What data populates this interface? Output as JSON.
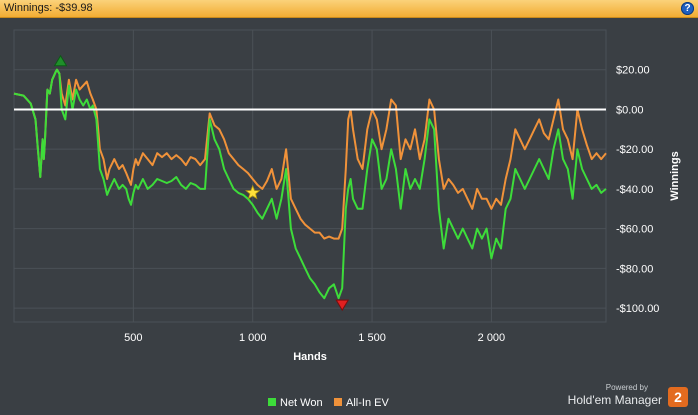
{
  "header": {
    "title": "Winnings: -$39.98",
    "help_label": "?"
  },
  "brand": {
    "powered_by": "Powered by",
    "name": "Hold'em Manager",
    "version": "2"
  },
  "colors": {
    "net_won": "#3ddc3a",
    "all_in_ev": "#f0923a",
    "zero_line": "#ffffff",
    "grid": "#4b5157",
    "plot_bg": "#3a3f44",
    "high_marker": "#1f8f2a",
    "low_marker": "#e02020",
    "star_marker": "#ffe03a"
  },
  "chart_data": {
    "type": "line",
    "xlabel": "Hands",
    "ylabel": "Winnings",
    "xlim": [
      0,
      2480
    ],
    "ylim": [
      -107,
      40
    ],
    "x_ticks": [
      500,
      1000,
      1500,
      2000
    ],
    "x_tick_labels": [
      "500",
      "1 000",
      "1 500",
      "2 000"
    ],
    "y_ticks": [
      20,
      0,
      -20,
      -40,
      -60,
      -80,
      -100
    ],
    "y_tick_labels": [
      "$20.00",
      "$0.00",
      "-$20.00",
      "-$40.00",
      "-$60.00",
      "-$80.00",
      "-$100.00"
    ],
    "grid": true,
    "legend_position": "bottom",
    "series": [
      {
        "name": "Net Won",
        "x": [
          0,
          40,
          70,
          90,
          100,
          110,
          120,
          125,
          130,
          140,
          150,
          160,
          175,
          180,
          190,
          200,
          215,
          230,
          245,
          260,
          275,
          290,
          305,
          320,
          330,
          345,
          360,
          375,
          390,
          400,
          420,
          440,
          455,
          470,
          480,
          490,
          500,
          510,
          520,
          540,
          560,
          580,
          600,
          620,
          640,
          660,
          680,
          700,
          720,
          740,
          760,
          780,
          800,
          820,
          840,
          860,
          880,
          900,
          920,
          940,
          960,
          980,
          1000,
          1020,
          1040,
          1060,
          1080,
          1100,
          1120,
          1140,
          1160,
          1180,
          1200,
          1220,
          1240,
          1260,
          1280,
          1300,
          1320,
          1340,
          1360,
          1375,
          1390,
          1400,
          1410,
          1420,
          1440,
          1460,
          1480,
          1500,
          1520,
          1540,
          1560,
          1580,
          1600,
          1620,
          1640,
          1660,
          1680,
          1700,
          1720,
          1740,
          1760,
          1780,
          1800,
          1820,
          1840,
          1860,
          1880,
          1900,
          1920,
          1940,
          1960,
          1980,
          2000,
          2020,
          2040,
          2060,
          2080,
          2100,
          2120,
          2140,
          2160,
          2180,
          2200,
          2220,
          2240,
          2260,
          2280,
          2300,
          2320,
          2340,
          2360,
          2380,
          2400,
          2420,
          2440,
          2460,
          2480
        ],
        "values": [
          8,
          7,
          3,
          -5,
          -20,
          -34,
          -15,
          -25,
          -15,
          10,
          8,
          15,
          19,
          20,
          18,
          0,
          -5,
          12,
          0,
          10,
          5,
          2,
          5,
          0,
          2,
          -5,
          -30,
          -35,
          -43,
          -40,
          -35,
          -40,
          -38,
          -40,
          -45,
          -48,
          -42,
          -38,
          -40,
          -35,
          -40,
          -38,
          -35,
          -36,
          -37,
          -36,
          -34,
          -38,
          -40,
          -37,
          -38,
          -40,
          -40,
          -5,
          -15,
          -20,
          -30,
          -35,
          -40,
          -42,
          -43,
          -45,
          -48,
          -52,
          -55,
          -50,
          -45,
          -55,
          -45,
          -30,
          -60,
          -70,
          -75,
          -80,
          -85,
          -88,
          -92,
          -95,
          -90,
          -88,
          -95,
          -90,
          -50,
          -40,
          -35,
          -45,
          -50,
          -50,
          -30,
          -15,
          -20,
          -40,
          -35,
          -20,
          -30,
          -50,
          -30,
          -40,
          -35,
          -40,
          -25,
          -5,
          -10,
          -50,
          -70,
          -55,
          -60,
          -65,
          -60,
          -65,
          -70,
          -60,
          -65,
          -60,
          -75,
          -65,
          -70,
          -50,
          -45,
          -30,
          -35,
          -40,
          -35,
          -30,
          -25,
          -30,
          -35,
          -20,
          -10,
          -25,
          -30,
          -45,
          -20,
          -30,
          -35,
          -40,
          -38,
          -42,
          -40
        ],
        "color": "#3ddc3a"
      },
      {
        "name": "All-In EV",
        "x": [
          0,
          40,
          70,
          90,
          100,
          110,
          120,
          125,
          130,
          140,
          150,
          160,
          175,
          180,
          190,
          200,
          215,
          230,
          245,
          260,
          275,
          290,
          305,
          320,
          330,
          345,
          360,
          375,
          390,
          400,
          420,
          440,
          455,
          470,
          480,
          490,
          500,
          510,
          520,
          540,
          560,
          580,
          600,
          620,
          640,
          660,
          680,
          700,
          720,
          740,
          760,
          780,
          800,
          820,
          840,
          860,
          880,
          900,
          920,
          940,
          960,
          980,
          1000,
          1020,
          1040,
          1060,
          1080,
          1100,
          1120,
          1140,
          1160,
          1180,
          1200,
          1220,
          1240,
          1260,
          1280,
          1300,
          1320,
          1340,
          1360,
          1375,
          1390,
          1400,
          1410,
          1420,
          1440,
          1460,
          1480,
          1500,
          1520,
          1540,
          1560,
          1580,
          1600,
          1620,
          1640,
          1660,
          1680,
          1700,
          1720,
          1740,
          1760,
          1780,
          1800,
          1820,
          1840,
          1860,
          1880,
          1900,
          1920,
          1940,
          1960,
          1980,
          2000,
          2020,
          2040,
          2060,
          2080,
          2100,
          2120,
          2140,
          2160,
          2180,
          2200,
          2220,
          2240,
          2260,
          2280,
          2300,
          2320,
          2340,
          2360,
          2380,
          2400,
          2420,
          2440,
          2460,
          2480
        ],
        "values": [
          8,
          7,
          3,
          -5,
          -20,
          -34,
          -15,
          -25,
          -15,
          10,
          8,
          15,
          19,
          20,
          18,
          8,
          2,
          15,
          5,
          15,
          10,
          12,
          14,
          8,
          5,
          0,
          -20,
          -25,
          -35,
          -30,
          -25,
          -30,
          -28,
          -32,
          -35,
          -38,
          -30,
          -25,
          -28,
          -22,
          -25,
          -28,
          -22,
          -24,
          -22,
          -25,
          -23,
          -25,
          -28,
          -24,
          -25,
          -28,
          -25,
          -2,
          -8,
          -10,
          -15,
          -22,
          -25,
          -28,
          -30,
          -32,
          -35,
          -38,
          -40,
          -36,
          -30,
          -40,
          -35,
          -20,
          -45,
          -50,
          -55,
          -58,
          -60,
          -62,
          -62,
          -65,
          -64,
          -65,
          -65,
          -60,
          -30,
          -5,
          0,
          -10,
          -25,
          -30,
          -10,
          0,
          -5,
          -20,
          -10,
          5,
          2,
          -25,
          -15,
          -20,
          -10,
          -25,
          -15,
          5,
          0,
          -25,
          -40,
          -35,
          -38,
          -42,
          -40,
          -45,
          -50,
          -40,
          -45,
          -45,
          -50,
          -45,
          -48,
          -35,
          -25,
          -10,
          -15,
          -20,
          -15,
          -10,
          -5,
          -12,
          -15,
          -5,
          5,
          -10,
          -15,
          -25,
          0,
          -10,
          -18,
          -25,
          -22,
          -25,
          -22
        ],
        "color": "#f0923a"
      }
    ],
    "markers": {
      "high": {
        "x": 195,
        "y": 20
      },
      "low": {
        "x": 1375,
        "y": -95
      },
      "star": {
        "x": 1000,
        "y": -42
      }
    }
  }
}
